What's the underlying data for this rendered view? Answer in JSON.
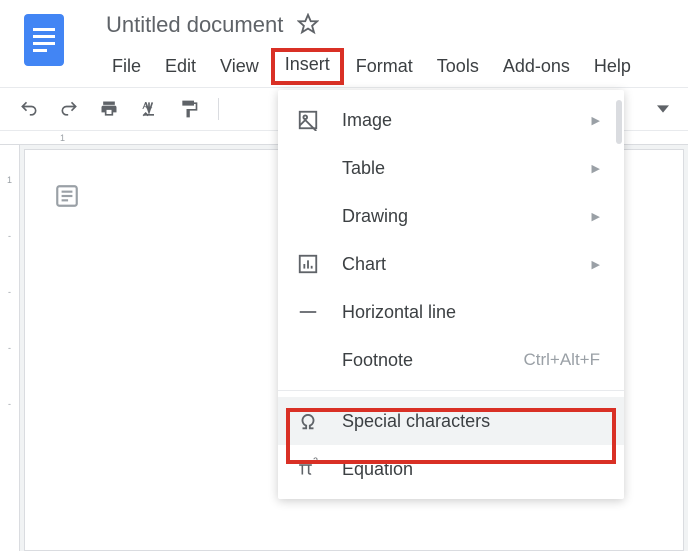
{
  "doc": {
    "title": "Untitled document"
  },
  "menubar": {
    "file": "File",
    "edit": "Edit",
    "view": "View",
    "insert": "Insert",
    "format": "Format",
    "tools": "Tools",
    "addons": "Add-ons",
    "help": "Help"
  },
  "dropdown": {
    "image": "Image",
    "table": "Table",
    "drawing": "Drawing",
    "chart": "Chart",
    "hline": "Horizontal line",
    "footnote": "Footnote",
    "footnote_shortcut": "Ctrl+Alt+F",
    "special": "Special characters",
    "equation": "Equation"
  },
  "ruler": {
    "t1": "1",
    "l1": "1"
  }
}
